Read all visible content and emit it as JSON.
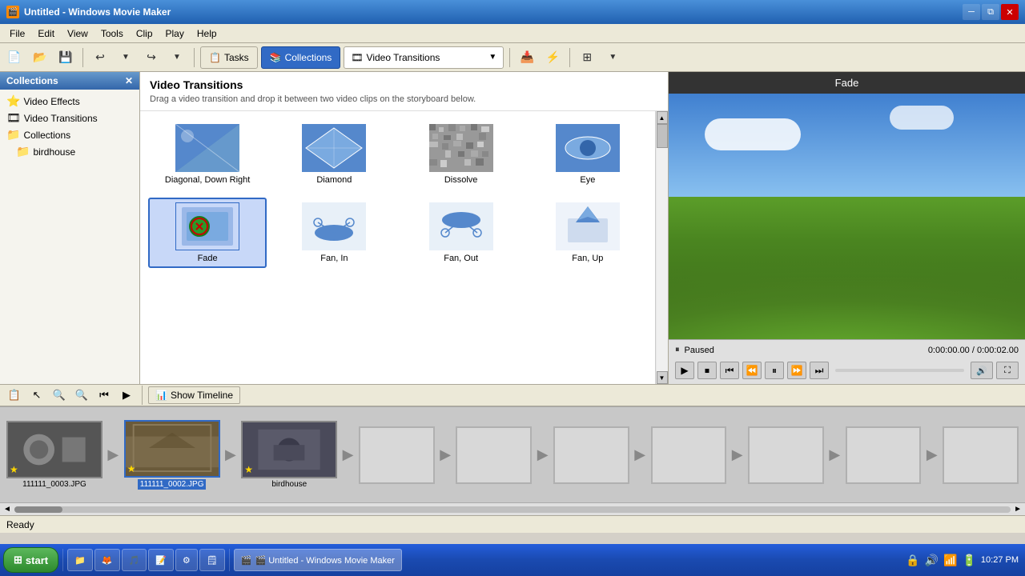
{
  "titlebar": {
    "title": "Untitled - Windows Movie Maker",
    "icon": "🎬"
  },
  "menubar": {
    "items": [
      "File",
      "Edit",
      "View",
      "Tools",
      "Clip",
      "Play",
      "Help"
    ]
  },
  "toolbar": {
    "tasks_label": "Tasks",
    "collections_label": "Collections",
    "dropdown_label": "Video Transitions",
    "dropdown_icon": "🎞"
  },
  "left_panel": {
    "header": "Collections",
    "items": [
      {
        "label": "Video Effects",
        "icon": "⭐"
      },
      {
        "label": "Video Transitions",
        "icon": "🎞"
      },
      {
        "label": "Collections",
        "icon": "📁"
      },
      {
        "label": "birdhouse",
        "icon": "📁",
        "indent": true
      }
    ]
  },
  "center_panel": {
    "title": "Video Transitions",
    "description": "Drag a video transition and drop it between two video clips on the storyboard below.",
    "transitions": [
      {
        "id": "diagonal",
        "label": "Diagonal, Down Right",
        "type": "diagonal"
      },
      {
        "id": "diamond",
        "label": "Diamond",
        "type": "diamond"
      },
      {
        "id": "dissolve",
        "label": "Dissolve",
        "type": "dissolve"
      },
      {
        "id": "eye",
        "label": "Eye",
        "type": "eye"
      },
      {
        "id": "fade",
        "label": "Fade",
        "type": "fade",
        "selected": true
      },
      {
        "id": "fan_in",
        "label": "Fan, In",
        "type": "fan_in"
      },
      {
        "id": "fan_out",
        "label": "Fan, Out",
        "type": "fan_out"
      },
      {
        "id": "fan_up",
        "label": "Fan, Up",
        "type": "fan_up"
      }
    ]
  },
  "preview": {
    "title": "Fade",
    "status": "Paused",
    "time_current": "0:00:00.00",
    "time_total": "0:00:02.00"
  },
  "bottom_toolbar": {
    "show_timeline_label": "Show Timeline"
  },
  "storyboard": {
    "clips": [
      {
        "id": "clip1",
        "label": "111111_0003.JPG",
        "selected": false
      },
      {
        "id": "clip2",
        "label": "111111_0002.JPG",
        "selected": true
      },
      {
        "id": "clip3",
        "label": "birdhouse",
        "selected": false
      }
    ]
  },
  "statusbar": {
    "text": "Ready"
  },
  "taskbar": {
    "start_label": "start",
    "apps": [
      {
        "label": "🎬 Untitled - Windows Movie Maker",
        "active": true
      }
    ],
    "time": "10:27 PM",
    "tray_icons": [
      "🔊",
      "📶",
      "🔋"
    ]
  }
}
